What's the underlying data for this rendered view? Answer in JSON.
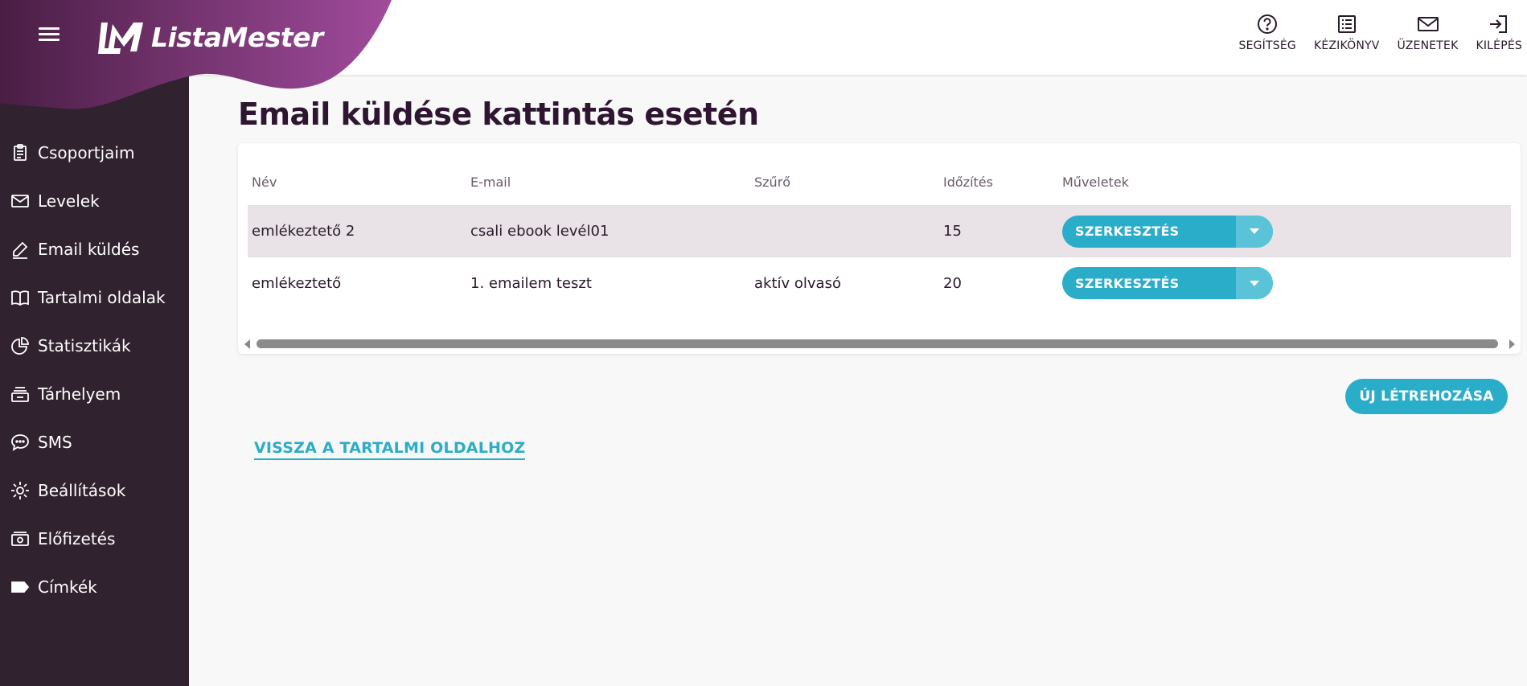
{
  "app": {
    "brand": "ListaMester",
    "accent_color": "#2aadc9",
    "sidebar_color": "#31222f",
    "brand_gradient": [
      "#4a1e45",
      "#a14b9c"
    ]
  },
  "header": {
    "menu_icon": "hamburger-icon",
    "actions": [
      {
        "label": "SEGÍTSÉG",
        "icon": "help-icon"
      },
      {
        "label": "KÉZIKÖNYV",
        "icon": "manual-icon"
      },
      {
        "label": "ÜZENETEK",
        "icon": "mail-icon"
      },
      {
        "label": "KILÉPÉS",
        "icon": "logout-icon"
      }
    ]
  },
  "sidebar": {
    "items": [
      {
        "label": "Csoportjaim",
        "icon": "clipboard-icon"
      },
      {
        "label": "Levelek",
        "icon": "envelope-icon"
      },
      {
        "label": "Email küldés",
        "icon": "pencil-icon"
      },
      {
        "label": "Tartalmi oldalak",
        "icon": "book-icon"
      },
      {
        "label": "Statisztikák",
        "icon": "pie-chart-icon"
      },
      {
        "label": "Tárhelyem",
        "icon": "storage-icon"
      },
      {
        "label": "SMS",
        "icon": "chat-icon"
      },
      {
        "label": "Beállítások",
        "icon": "gear-icon"
      },
      {
        "label": "Előfizetés",
        "icon": "money-icon"
      },
      {
        "label": "Címkék",
        "icon": "tag-icon"
      }
    ]
  },
  "main": {
    "title": "Email küldése kattintás esetén",
    "table": {
      "columns": [
        "Név",
        "E-mail",
        "Szűrő",
        "Időzítés",
        "Műveletek"
      ],
      "rows": [
        {
          "name": "emlékeztető 2",
          "email": "csali ebook levél01",
          "filter": "",
          "timing": "15",
          "action": "SZERKESZTÉS"
        },
        {
          "name": "emlékeztető",
          "email": "1. emailem teszt",
          "filter": "aktív olvasó",
          "timing": "20",
          "action": "SZERKESZTÉS"
        }
      ]
    },
    "new_button": "ÚJ LÉTREHOZÁSA",
    "back_link": "VISSZA A TARTALMI OLDALHOZ"
  }
}
